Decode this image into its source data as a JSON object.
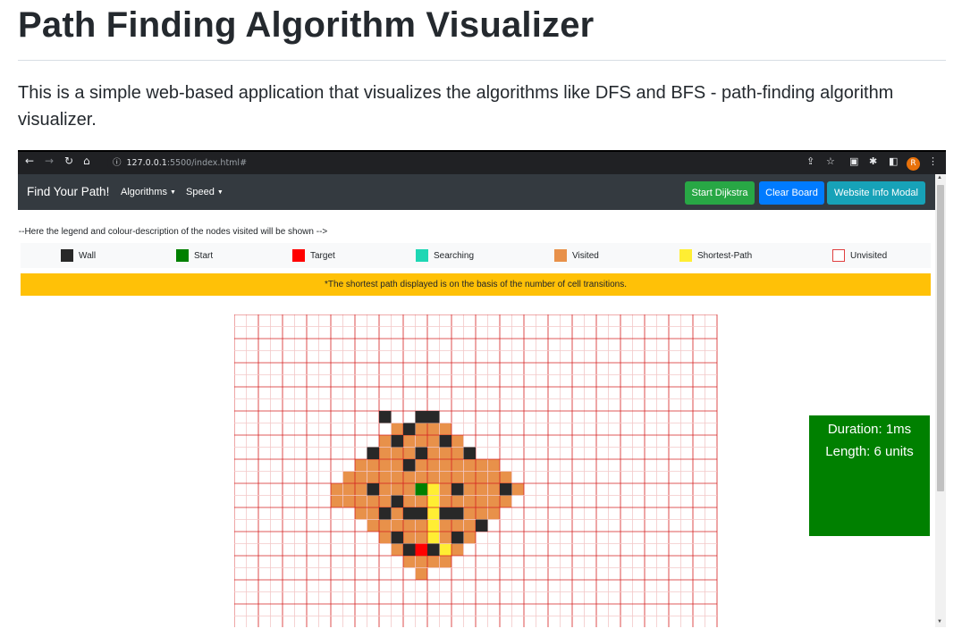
{
  "page": {
    "title": "Path Finding Algorithm Visualizer",
    "description": "This is a simple web-based application that visualizes the algorithms like DFS and BFS - path-finding algorithm visualizer."
  },
  "browser": {
    "url_host": "127.0.0.1",
    "url_path": ":5500/index.html#",
    "profile_initial": "R"
  },
  "navbar": {
    "brand": "Find Your Path!",
    "algorithms_label": "Algorithms",
    "speed_label": "Speed",
    "start_button": "Start Dijkstra",
    "clear_button": "Clear Board",
    "info_button": "Website Info Modal"
  },
  "comment_text": "!--Here the legend and colour-description of the nodes visited will be shown -->",
  "legend": [
    {
      "label": "Wall",
      "color": "#282828"
    },
    {
      "label": "Start",
      "color": "#008000"
    },
    {
      "label": "Target",
      "color": "#ff0000"
    },
    {
      "label": "Searching",
      "color": "#1ed7b4"
    },
    {
      "label": "Visited",
      "color": "#e8914a"
    },
    {
      "label": "Shortest-Path",
      "color": "#ffee33"
    },
    {
      "label": "Unvisited",
      "color": "#ffffff"
    }
  ],
  "notice": "*The shortest path displayed is on the basis of the number of cell transitions.",
  "stats": {
    "duration": "Duration: 1ms",
    "length": "Length: 6 units"
  },
  "colors": {
    "wall": "#282828",
    "start": "#008000",
    "target": "#ff0000",
    "visited": "#e8914a",
    "path": "#ffee33",
    "grid_line": "#d42020",
    "grid_line_light": "#f3c8c8",
    "success": "#28a745",
    "primary": "#007bff",
    "info": "#17a2b8",
    "navbar": "#343a40",
    "warning": "#ffc107"
  },
  "grid": {
    "cols": 40,
    "rows": 26,
    "visited": [
      [
        15,
        8
      ],
      [
        16,
        8
      ],
      [
        16,
        9
      ],
      [
        17,
        9
      ],
      [
        15,
        9
      ],
      [
        14,
        9
      ],
      [
        13,
        9
      ],
      [
        12,
        10
      ],
      [
        13,
        10
      ],
      [
        14,
        10
      ],
      [
        15,
        10
      ],
      [
        16,
        10
      ],
      [
        17,
        10
      ],
      [
        18,
        10
      ],
      [
        11,
        11
      ],
      [
        12,
        11
      ],
      [
        13,
        11
      ],
      [
        14,
        11
      ],
      [
        15,
        11
      ],
      [
        16,
        11
      ],
      [
        17,
        11
      ],
      [
        18,
        11
      ],
      [
        19,
        11
      ],
      [
        10,
        12
      ],
      [
        11,
        12
      ],
      [
        12,
        12
      ],
      [
        13,
        12
      ],
      [
        14,
        12
      ],
      [
        15,
        12
      ],
      [
        16,
        12
      ],
      [
        17,
        12
      ],
      [
        18,
        12
      ],
      [
        19,
        12
      ],
      [
        20,
        12
      ],
      [
        21,
        12
      ],
      [
        9,
        13
      ],
      [
        10,
        13
      ],
      [
        11,
        13
      ],
      [
        12,
        13
      ],
      [
        13,
        13
      ],
      [
        14,
        13
      ],
      [
        15,
        13
      ],
      [
        16,
        13
      ],
      [
        17,
        13
      ],
      [
        18,
        13
      ],
      [
        19,
        13
      ],
      [
        20,
        13
      ],
      [
        21,
        13
      ],
      [
        22,
        13
      ],
      [
        8,
        14
      ],
      [
        9,
        14
      ],
      [
        10,
        14
      ],
      [
        11,
        14
      ],
      [
        12,
        14
      ],
      [
        13,
        14
      ],
      [
        14,
        14
      ],
      [
        15,
        14
      ],
      [
        16,
        14
      ],
      [
        17,
        14
      ],
      [
        18,
        14
      ],
      [
        19,
        14
      ],
      [
        20,
        14
      ],
      [
        21,
        14
      ],
      [
        22,
        14
      ],
      [
        23,
        14
      ],
      [
        8,
        15
      ],
      [
        9,
        15
      ],
      [
        10,
        15
      ],
      [
        11,
        15
      ],
      [
        12,
        15
      ],
      [
        13,
        15
      ],
      [
        14,
        15
      ],
      [
        15,
        15
      ],
      [
        16,
        15
      ],
      [
        17,
        15
      ],
      [
        18,
        15
      ],
      [
        19,
        15
      ],
      [
        20,
        15
      ],
      [
        21,
        15
      ],
      [
        22,
        15
      ],
      [
        10,
        16
      ],
      [
        11,
        16
      ],
      [
        12,
        16
      ],
      [
        13,
        16
      ],
      [
        14,
        16
      ],
      [
        15,
        16
      ],
      [
        16,
        16
      ],
      [
        17,
        16
      ],
      [
        18,
        16
      ],
      [
        19,
        16
      ],
      [
        20,
        16
      ],
      [
        21,
        16
      ],
      [
        11,
        17
      ],
      [
        12,
        17
      ],
      [
        13,
        17
      ],
      [
        14,
        17
      ],
      [
        15,
        17
      ],
      [
        16,
        17
      ],
      [
        17,
        17
      ],
      [
        18,
        17
      ],
      [
        19,
        17
      ],
      [
        20,
        17
      ],
      [
        12,
        18
      ],
      [
        13,
        18
      ],
      [
        14,
        18
      ],
      [
        15,
        18
      ],
      [
        16,
        18
      ],
      [
        17,
        18
      ],
      [
        18,
        18
      ],
      [
        19,
        18
      ],
      [
        13,
        19
      ],
      [
        14,
        19
      ],
      [
        15,
        19
      ],
      [
        16,
        19
      ],
      [
        17,
        19
      ],
      [
        18,
        19
      ],
      [
        14,
        20
      ],
      [
        15,
        20
      ],
      [
        16,
        20
      ],
      [
        17,
        20
      ],
      [
        15,
        21
      ]
    ],
    "walls": [
      [
        15,
        8
      ],
      [
        12,
        8
      ],
      [
        14,
        9
      ],
      [
        16,
        8
      ],
      [
        13,
        10
      ],
      [
        17,
        10
      ],
      [
        11,
        11
      ],
      [
        19,
        11
      ],
      [
        15,
        11
      ],
      [
        14,
        12
      ],
      [
        11,
        14
      ],
      [
        18,
        14
      ],
      [
        22,
        14
      ],
      [
        13,
        15
      ],
      [
        14,
        16
      ],
      [
        15,
        16
      ],
      [
        18,
        16
      ],
      [
        17,
        16
      ],
      [
        12,
        16
      ],
      [
        20,
        17
      ],
      [
        13,
        18
      ],
      [
        18,
        18
      ],
      [
        16,
        19
      ],
      [
        15,
        19
      ],
      [
        14,
        19
      ]
    ],
    "path": [
      [
        16,
        14
      ],
      [
        16,
        15
      ],
      [
        16,
        16
      ],
      [
        16,
        17
      ],
      [
        16,
        18
      ],
      [
        16,
        19
      ],
      [
        17,
        19
      ]
    ],
    "start": [
      15,
      14
    ],
    "target": [
      15,
      19
    ]
  }
}
